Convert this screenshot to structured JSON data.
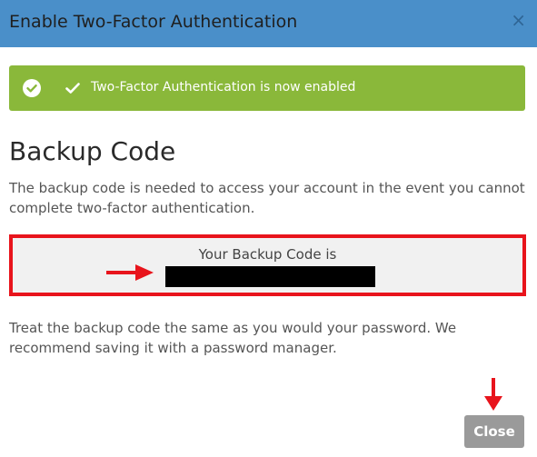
{
  "dialog": {
    "title": "Enable Two-Factor Authentication",
    "close_icon": "×",
    "header_color": "#4a8fc9"
  },
  "alert": {
    "message": "Two-Factor Authentication is now enabled",
    "status_color": "#8ab83a",
    "icons": [
      "check-circle-icon",
      "check-icon"
    ]
  },
  "backup": {
    "heading": "Backup Code",
    "description": "The backup code is needed to access your account in the event you cannot complete two-factor authentication.",
    "code_label": "Your Backup Code is",
    "highlight_color": "#e8141c",
    "note": "Treat the backup code the same as you would your password. We recommend saving it with a password manager."
  },
  "footer": {
    "close_label": "Close"
  }
}
